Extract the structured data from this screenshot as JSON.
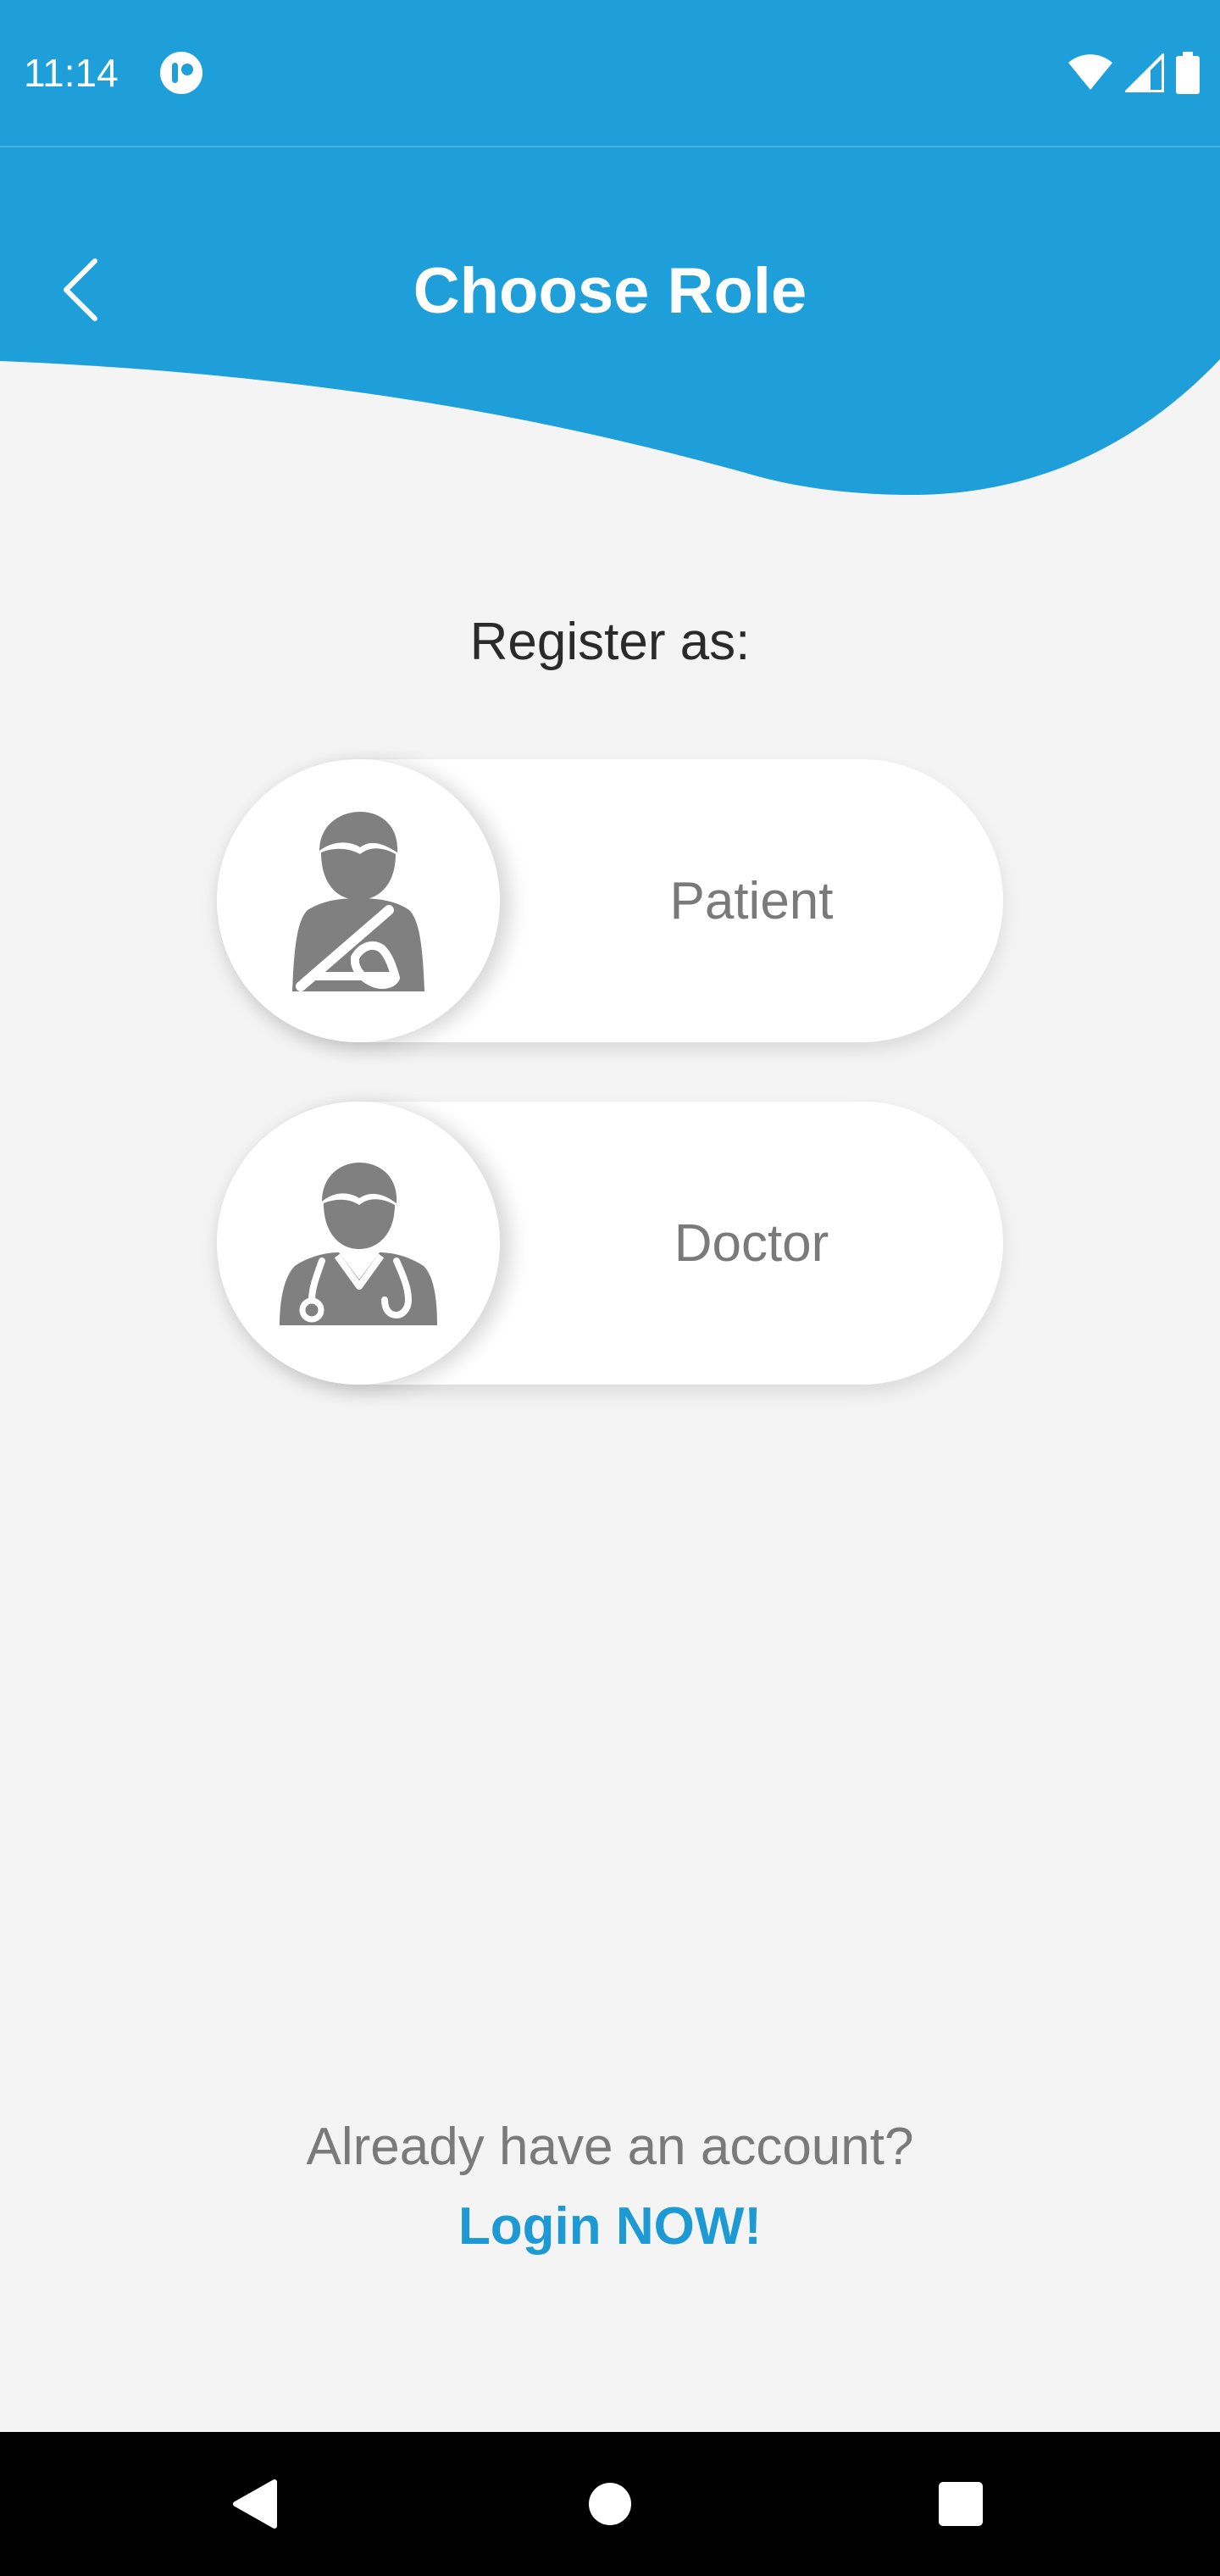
{
  "status_bar": {
    "time": "11:14",
    "icons": [
      "app-notification-icon",
      "wifi-icon",
      "signal-icon",
      "battery-icon"
    ]
  },
  "header": {
    "title": "Choose Role",
    "back_icon": "chevron-left-icon",
    "background_color": "#1e9fda"
  },
  "main": {
    "register_label": "Register as:",
    "roles": [
      {
        "label": "Patient",
        "icon": "patient-icon"
      },
      {
        "label": "Doctor",
        "icon": "doctor-icon"
      }
    ]
  },
  "footer": {
    "already_text": "Already have an account?",
    "login_link": "Login NOW!",
    "link_color": "#1d9ad4"
  },
  "nav_bar": {
    "buttons": [
      "back-triangle-icon",
      "home-circle-icon",
      "recents-square-icon"
    ]
  }
}
